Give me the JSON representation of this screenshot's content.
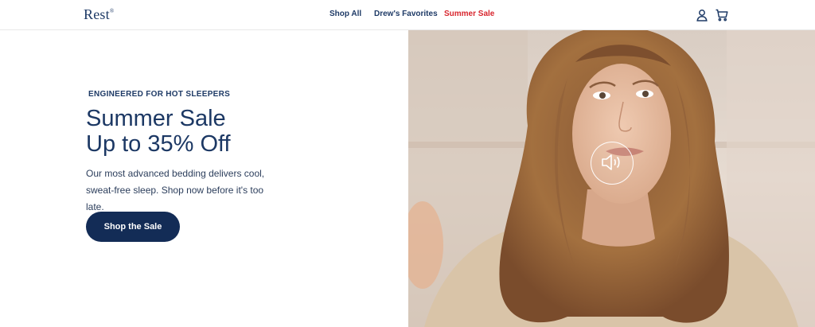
{
  "header": {
    "logo": "Rest",
    "logo_mark": "®",
    "nav": [
      {
        "label": "Shop All"
      },
      {
        "label": "Drew's Favorites"
      },
      {
        "label": "Summer Sale",
        "color": "#d8262e"
      }
    ],
    "icons": [
      "account-icon",
      "cart-icon"
    ]
  },
  "hero": {
    "eyebrow": "ENGINEERED FOR HOT SLEEPERS",
    "headline_line1": "Summer Sale",
    "headline_line2": "Up to 35% Off",
    "body_line1": "Our most advanced bedding delivers cool,",
    "body_line2": "sweat-free sleep. Shop now before it's too late.",
    "cta_label": "Shop the Sale",
    "cta_color": "#132c56"
  },
  "video": {
    "sound_icon": "speaker-icon"
  },
  "colors": {
    "brand_navy": "#1e3a66",
    "sale_red": "#d8262e"
  }
}
